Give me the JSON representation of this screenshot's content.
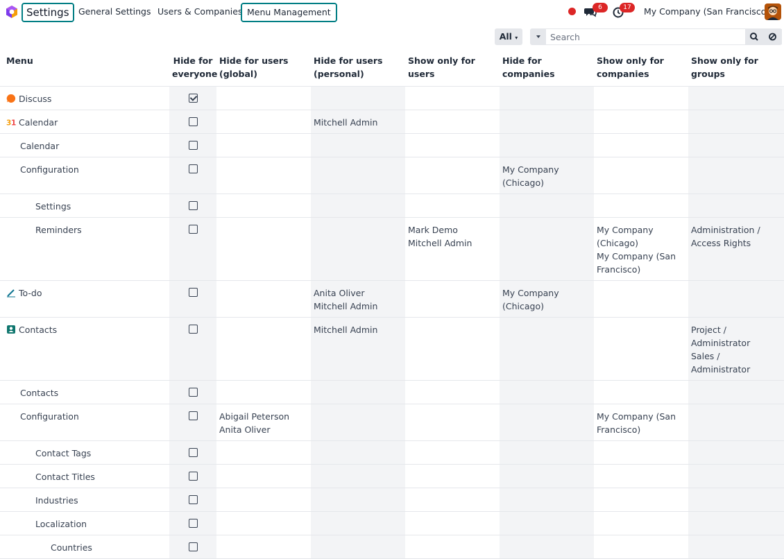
{
  "navbar": {
    "app_name": "Settings",
    "menu_items": [
      "General Settings",
      "Users & Companies",
      "Menu Management"
    ],
    "messages_count": "6",
    "activities_count": "17",
    "company": "My Company (San Francisco)",
    "accent_color": "#017e84",
    "icons": [
      "odoo-logo-icon",
      "record-dot-icon",
      "chat-icon",
      "clock-icon",
      "avatar"
    ]
  },
  "search": {
    "filter_label": "All",
    "placeholder": "Search"
  },
  "table": {
    "headers": [
      "Menu",
      "Hide for everyone",
      "Hide for users (global)",
      "Hide for users (personal)",
      "Show only for users",
      "Hide for companies",
      "Show only for companies",
      "Show only for groups"
    ],
    "rows": [
      {
        "name": "Discuss",
        "icon": "discuss-icon",
        "level": 0,
        "hide_everyone": true,
        "users_global": [],
        "users_personal": [],
        "show_users": [],
        "hide_companies": [],
        "show_companies": [],
        "groups": []
      },
      {
        "name": "Calendar",
        "icon": "calendar-icon",
        "level": 0,
        "hide_everyone": false,
        "users_global": [],
        "users_personal": [
          "Mitchell Admin"
        ],
        "show_users": [],
        "hide_companies": [],
        "show_companies": [],
        "groups": []
      },
      {
        "name": "Calendar",
        "level": 1,
        "hide_everyone": false,
        "users_global": [],
        "users_personal": [],
        "show_users": [],
        "hide_companies": [],
        "show_companies": [],
        "groups": []
      },
      {
        "name": "Configuration",
        "level": 1,
        "hide_everyone": false,
        "users_global": [],
        "users_personal": [],
        "show_users": [],
        "hide_companies": [
          "My Company",
          "(Chicago)"
        ],
        "show_companies": [],
        "groups": []
      },
      {
        "name": "Settings",
        "level": 2,
        "hide_everyone": false,
        "users_global": [],
        "users_personal": [],
        "show_users": [],
        "hide_companies": [],
        "show_companies": [],
        "groups": []
      },
      {
        "name": "Reminders",
        "level": 2,
        "hide_everyone": false,
        "users_global": [],
        "users_personal": [],
        "show_users": [
          "Mark Demo",
          "Mitchell Admin"
        ],
        "hide_companies": [],
        "show_companies": [
          "My Company",
          "(Chicago)",
          "My Company (San",
          "Francisco)"
        ],
        "groups": [
          "Administration /",
          "Access Rights"
        ]
      },
      {
        "name": "To-do",
        "icon": "todo-icon",
        "level": 0,
        "hide_everyone": false,
        "users_global": [],
        "users_personal": [
          "Anita Oliver",
          "Mitchell Admin"
        ],
        "show_users": [],
        "hide_companies": [
          "My Company",
          "(Chicago)"
        ],
        "show_companies": [],
        "groups": []
      },
      {
        "name": "Contacts",
        "icon": "contacts-icon",
        "level": 0,
        "hide_everyone": false,
        "users_global": [],
        "users_personal": [
          "Mitchell Admin"
        ],
        "show_users": [],
        "hide_companies": [],
        "show_companies": [],
        "groups": [
          "Project /",
          "Administrator",
          "Sales / Administrator"
        ]
      },
      {
        "name": "Contacts",
        "level": 1,
        "hide_everyone": false,
        "users_global": [],
        "users_personal": [],
        "show_users": [],
        "hide_companies": [],
        "show_companies": [],
        "groups": []
      },
      {
        "name": "Configuration",
        "level": 1,
        "hide_everyone": false,
        "users_global": [
          "Abigail Peterson",
          "Anita Oliver"
        ],
        "users_personal": [],
        "show_users": [],
        "hide_companies": [],
        "show_companies": [
          "My Company (San",
          "Francisco)"
        ],
        "groups": []
      },
      {
        "name": "Contact Tags",
        "level": 2,
        "hide_everyone": false,
        "users_global": [],
        "users_personal": [],
        "show_users": [],
        "hide_companies": [],
        "show_companies": [],
        "groups": []
      },
      {
        "name": "Contact Titles",
        "level": 2,
        "hide_everyone": false,
        "users_global": [],
        "users_personal": [],
        "show_users": [],
        "hide_companies": [],
        "show_companies": [],
        "groups": []
      },
      {
        "name": "Industries",
        "level": 2,
        "hide_everyone": false,
        "users_global": [],
        "users_personal": [],
        "show_users": [],
        "hide_companies": [],
        "show_companies": [],
        "groups": []
      },
      {
        "name": "Localization",
        "level": 2,
        "hide_everyone": false,
        "users_global": [],
        "users_personal": [],
        "show_users": [],
        "hide_companies": [],
        "show_companies": [],
        "groups": []
      },
      {
        "name": "Countries",
        "level": 3,
        "hide_everyone": false,
        "users_global": [],
        "users_personal": [],
        "show_users": [],
        "hide_companies": [],
        "show_companies": [],
        "groups": []
      }
    ]
  }
}
